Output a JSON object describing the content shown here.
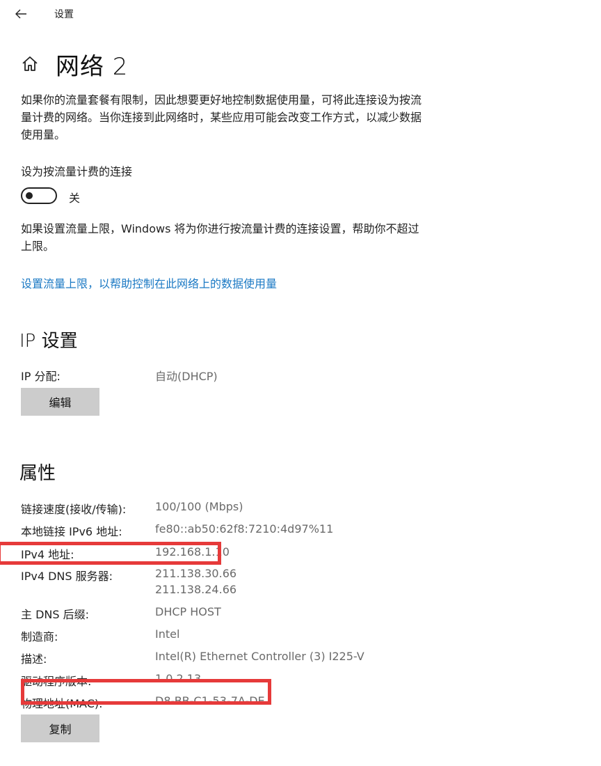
{
  "header": {
    "app_title": "设置",
    "back_icon": "back-arrow-icon"
  },
  "page": {
    "title": "网络 2",
    "home_icon": "home-icon"
  },
  "description": "如果你的流量套餐有限制，因此想要更好地控制数据使用量，可将此连接设为按流量计费的网络。当你连接到此网络时，某些应用可能会改变工作方式，以减少数据使用量。",
  "metered": {
    "label": "设为按流量计费的连接",
    "toggle_state": "关",
    "limit_desc": "如果设置流量上限，Windows 将为你进行按流量计费的连接设置，帮助你不超过上限。",
    "limit_link": "设置流量上限，以帮助控制在此网络上的数据使用量"
  },
  "ip_settings": {
    "heading": "IP 设置",
    "assign_label": "IP 分配:",
    "assign_value": "自动(DHCP)",
    "edit_button": "编辑"
  },
  "properties": {
    "heading": "属性",
    "rows": [
      {
        "label": "链接速度(接收/传输):",
        "values": [
          "100/100 (Mbps)"
        ]
      },
      {
        "label": "本地链接 IPv6 地址:",
        "values": [
          "fe80::ab50:62f8:7210:4d97%11"
        ]
      },
      {
        "label": "IPv4 地址:",
        "values": [
          "192.168.1.10"
        ]
      },
      {
        "label": "IPv4 DNS 服务器:",
        "values": [
          "211.138.30.66",
          "211.138.24.66"
        ]
      },
      {
        "label": "主 DNS 后缀:",
        "values": [
          "DHCP HOST"
        ]
      },
      {
        "label": "制造商:",
        "values": [
          "Intel"
        ]
      },
      {
        "label": "描述:",
        "values": [
          "Intel(R) Ethernet Controller (3) I225-V"
        ]
      },
      {
        "label": "驱动程序版本:",
        "values": [
          "1.0.2.13"
        ]
      },
      {
        "label": "物理地址(MAC):",
        "values": [
          "D8-BB-C1-53-7A-DE"
        ]
      }
    ],
    "copy_button": "复制"
  },
  "colors": {
    "link": "#1b79c4",
    "button_bg": "#cccccc",
    "highlight": "#e63a3a"
  }
}
